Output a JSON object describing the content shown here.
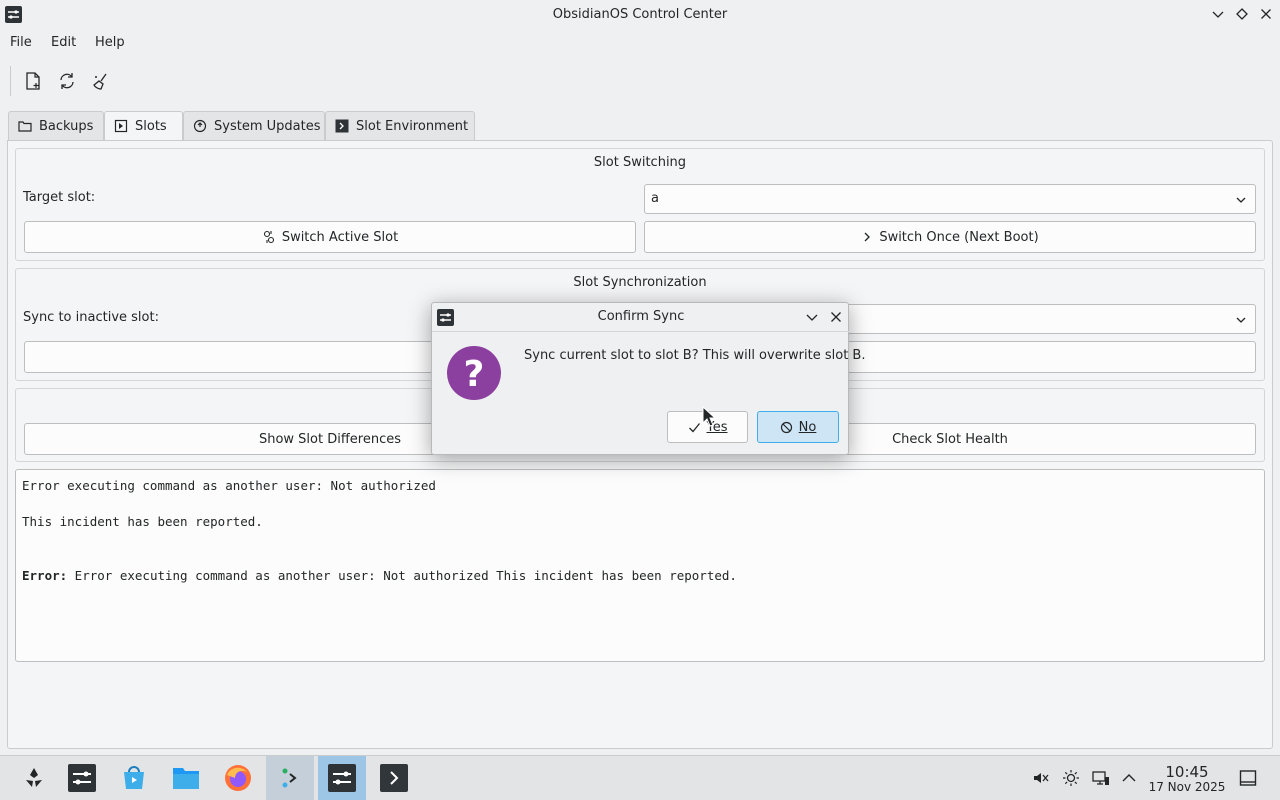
{
  "window": {
    "title": "ObsidianOS Control Center"
  },
  "menu": {
    "file": "File",
    "edit": "Edit",
    "help": "Help"
  },
  "tabs": [
    {
      "label": "Backups",
      "icon": "folder-icon"
    },
    {
      "label": "Slots",
      "icon": "slot-icon"
    },
    {
      "label": "System Updates",
      "icon": "update-icon"
    },
    {
      "label": "Slot Environment",
      "icon": "terminal-icon"
    }
  ],
  "slot_switching": {
    "title": "Slot Switching",
    "target_label": "Target slot:",
    "target_value": "a",
    "switch_active": "Switch Active Slot",
    "switch_once": "Switch Once (Next Boot)"
  },
  "slot_sync": {
    "title": "Slot Synchronization",
    "sync_label": "Sync to inactive slot:"
  },
  "tools": {
    "show_diff": "Show Slot Differences",
    "check_health": "Check Slot Health"
  },
  "output": {
    "line1": "Error executing command as another user: Not authorized",
    "line2": "This incident has been reported.",
    "error_prefix": "Error:",
    "error_text": " Error executing command as another user: Not authorized This incident has been reported."
  },
  "dialog": {
    "title": "Confirm Sync",
    "message": "Sync current slot to slot B? This will overwrite slot B.",
    "yes": "Yes",
    "no": "No"
  },
  "taskbar": {
    "time": "10:45",
    "date": "17 Nov 2025"
  },
  "colors": {
    "accent": "#3daee9",
    "question": "#8b3f9e"
  }
}
